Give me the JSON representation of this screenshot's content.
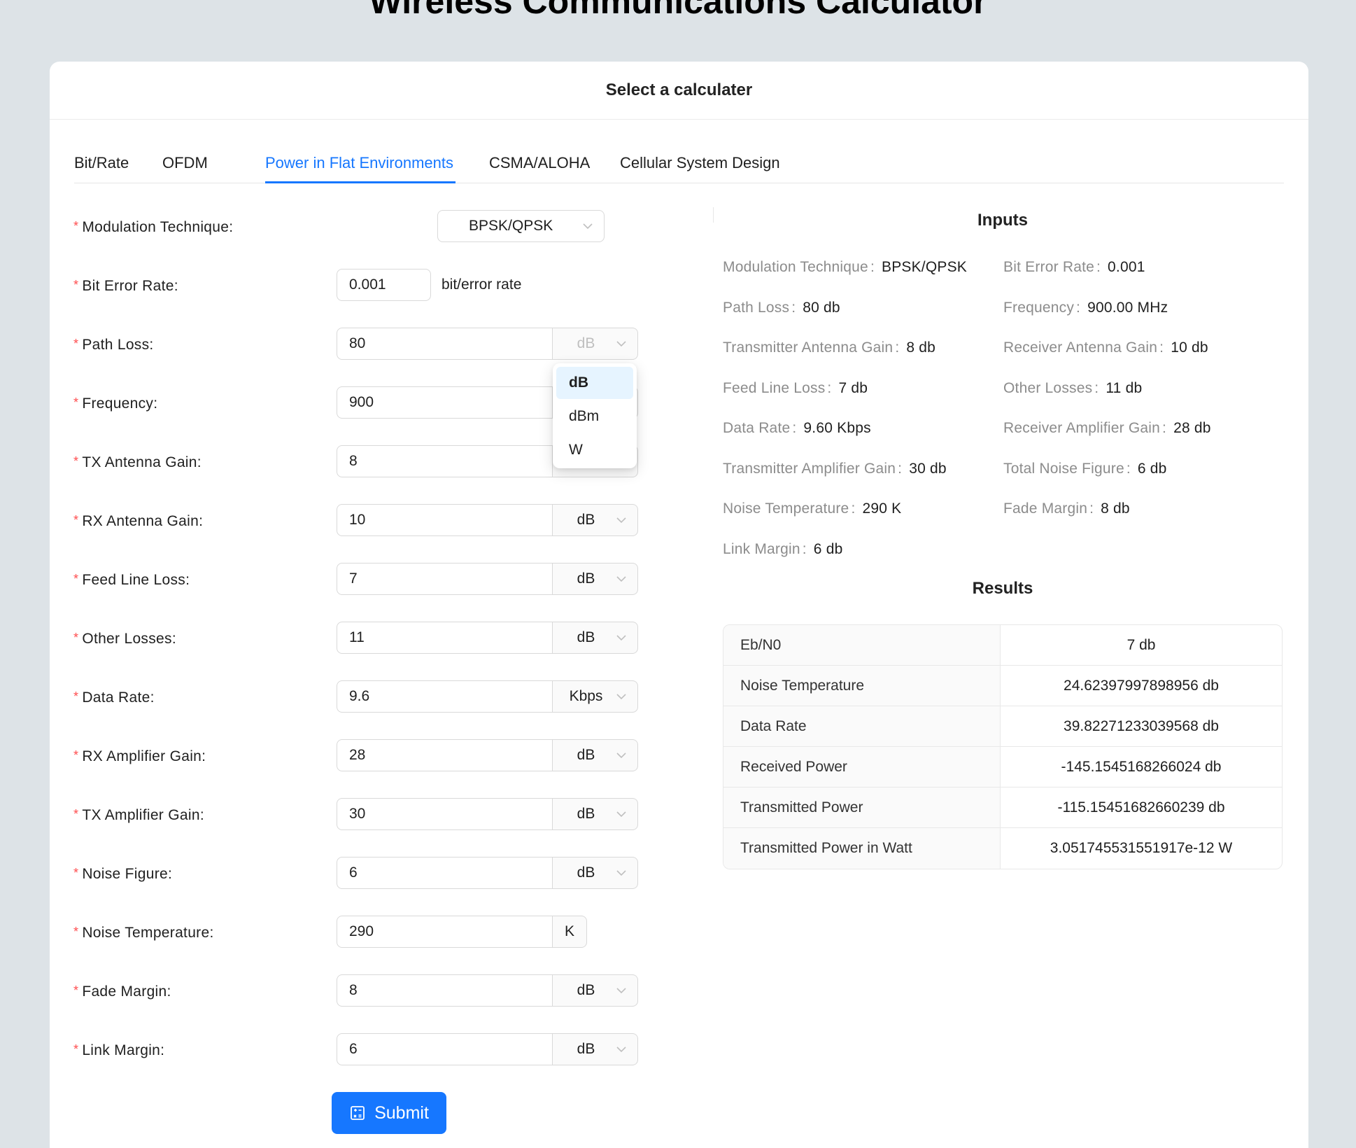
{
  "page_title": "Wireless Communications Calculator",
  "card_title": "Select a calculater",
  "tabs": [
    {
      "label": "Bit/Rate",
      "active": false
    },
    {
      "label": "OFDM",
      "active": false
    },
    {
      "label": "Power in Flat Environments",
      "active": true
    },
    {
      "label": "CSMA/ALOHA",
      "active": false
    },
    {
      "label": "Cellular System Design",
      "active": false
    }
  ],
  "form": {
    "modulation": {
      "label": "Modulation Technique",
      "value": "BPSK/QPSK"
    },
    "ber": {
      "label": "Bit Error Rate",
      "value": "0.001",
      "suffix": "bit/error rate"
    },
    "path_loss": {
      "label": "Path Loss",
      "value": "80",
      "unit": "dB"
    },
    "frequency": {
      "label": "Frequency",
      "value": "900"
    },
    "tx_antenna_gain": {
      "label": "TX Antenna Gain",
      "value": "8"
    },
    "rx_antenna_gain": {
      "label": "RX Antenna Gain",
      "value": "10",
      "unit": "dB"
    },
    "feed_line_loss": {
      "label": "Feed Line Loss",
      "value": "7",
      "unit": "dB"
    },
    "other_losses": {
      "label": "Other Losses",
      "value": "11",
      "unit": "dB"
    },
    "data_rate": {
      "label": "Data Rate",
      "value": "9.6",
      "unit": "Kbps"
    },
    "rx_amplifier_gain": {
      "label": "RX Amplifier Gain",
      "value": "28",
      "unit": "dB"
    },
    "tx_amplifier_gain": {
      "label": "TX Amplifier Gain",
      "value": "30",
      "unit": "dB"
    },
    "noise_figure": {
      "label": "Noise Figure",
      "value": "6",
      "unit": "dB"
    },
    "noise_temperature": {
      "label": "Noise Temperature",
      "value": "290",
      "unit": "K"
    },
    "fade_margin": {
      "label": "Fade Margin",
      "value": "8",
      "unit": "dB"
    },
    "link_margin": {
      "label": "Link Margin",
      "value": "6",
      "unit": "dB"
    },
    "required_mark": "*",
    "colon": ":",
    "submit_label": "Submit"
  },
  "unit_dropdown": {
    "options": [
      "dB",
      "dBm",
      "W"
    ],
    "selected": "dB"
  },
  "inputs_panel": {
    "title": "Inputs",
    "items": [
      {
        "k": "Modulation Technique",
        "v": "BPSK/QPSK"
      },
      {
        "k": "Bit Error Rate",
        "v": "0.001"
      },
      {
        "k": "Path Loss",
        "v": "80 db"
      },
      {
        "k": "Frequency",
        "v": "900.00 MHz"
      },
      {
        "k": "Transmitter Antenna Gain",
        "v": "8 db"
      },
      {
        "k": "Receiver Antenna Gain",
        "v": "10 db"
      },
      {
        "k": "Feed Line Loss",
        "v": "7 db"
      },
      {
        "k": "Other Losses",
        "v": "11 db"
      },
      {
        "k": "Data Rate",
        "v": "9.60 Kbps"
      },
      {
        "k": "Receiver Amplifier Gain",
        "v": "28 db"
      },
      {
        "k": "Transmitter Amplifier Gain",
        "v": "30 db"
      },
      {
        "k": "Total Noise Figure",
        "v": "6 db"
      },
      {
        "k": "Noise Temperature",
        "v": "290 K"
      },
      {
        "k": "Fade Margin",
        "v": "8 db"
      },
      {
        "k": "Link Margin",
        "v": "6 db"
      }
    ]
  },
  "results_panel": {
    "title": "Results",
    "rows": [
      {
        "k": "Eb/N0",
        "v": "7 db"
      },
      {
        "k": "Noise Temperature",
        "v": "24.62397997898956 db"
      },
      {
        "k": "Data Rate",
        "v": "39.82271233039568 db"
      },
      {
        "k": "Received Power",
        "v": "-145.1545168266024 db"
      },
      {
        "k": "Transmitted Power",
        "v": "-115.15451682660239 db"
      },
      {
        "k": "Transmitted Power in Watt",
        "v": "3.051745531551917e-12 W"
      }
    ]
  },
  "colors": {
    "accent": "#1677ff",
    "required": "#ff4d4f",
    "background": "#dde3e7"
  }
}
